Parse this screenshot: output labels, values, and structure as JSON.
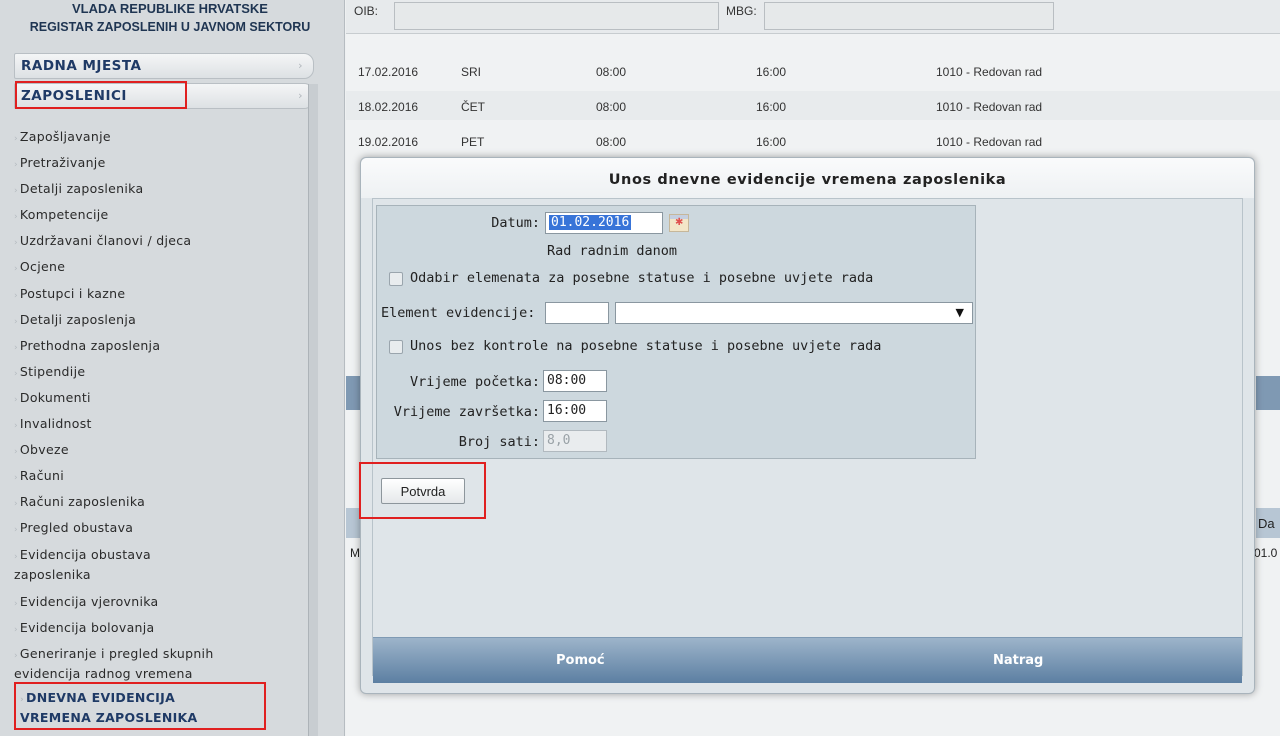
{
  "header": {
    "line1": "VLADA REPUBLIKE HRVATSKE",
    "line2": "REGISTAR ZAPOSLENIH U JAVNOM SEKTORU"
  },
  "topbar": {
    "oib_label": "OIB:",
    "mbg_label": "MBG:"
  },
  "sidebar": {
    "sections": [
      {
        "label": "RADNA MJESTA"
      },
      {
        "label": "ZAPOSLENICI"
      }
    ],
    "items": [
      {
        "label": "Zapošljavanje"
      },
      {
        "label": "Pretraživanje"
      },
      {
        "label": "Detalji zaposlenika"
      },
      {
        "label": "Kompetencije"
      },
      {
        "label": "Uzdržavani članovi / djeca"
      },
      {
        "label": "Ocjene"
      },
      {
        "label": "Postupci i kazne"
      },
      {
        "label": "Detalji zaposlenja"
      },
      {
        "label": "Prethodna zaposlenja"
      },
      {
        "label": "Stipendije"
      },
      {
        "label": "Dokumenti"
      },
      {
        "label": "Invalidnost"
      },
      {
        "label": "Obveze"
      },
      {
        "label": "Računi"
      },
      {
        "label": "Računi zaposlenika"
      },
      {
        "label": "Pregled obustava"
      },
      {
        "label": "Evidencija obustava",
        "label2": "zaposlenika"
      },
      {
        "label": "Evidencija vjerovnika"
      },
      {
        "label": "Evidencija bolovanja"
      },
      {
        "label": "Generiranje i pregled skupnih",
        "label2": "evidencija radnog vremena"
      },
      {
        "label": "DNEVNA EVIDENCIJA",
        "label2": "VREMENA ZAPOSLENIKA"
      }
    ]
  },
  "table": {
    "rows": [
      {
        "date": "17.02.2016",
        "day": "SRI",
        "start": "08:00",
        "end": "16:00",
        "type": "1010 - Redovan rad"
      },
      {
        "date": "18.02.2016",
        "day": "ČET",
        "start": "08:00",
        "end": "16:00",
        "type": "1010 - Redovan rad"
      },
      {
        "date": "19.02.2016",
        "day": "PET",
        "start": "08:00",
        "end": "16:00",
        "type": "1010 - Redovan rad"
      }
    ],
    "peek_right_1": "Da",
    "peek_right_2": "01.0",
    "peek_left_m": "M"
  },
  "modal": {
    "title": "Unos dnevne evidencije vremena zaposlenika",
    "datum_label": "Datum:",
    "datum_value": "01.02.2016",
    "day_type": "Rad radnim danom",
    "checkbox1_label": "Odabir elemenata za posebne statuse i posebne uvjete rada",
    "element_label": "Element evidencije:",
    "element_code": "",
    "element_select": "",
    "checkbox2_label": "Unos bez kontrole na posebne statuse i posebne uvjete rada",
    "start_label": "Vrijeme početka:",
    "start_value": "08:00",
    "end_label": "Vrijeme završetka:",
    "end_value": "16:00",
    "hours_label": "Broj sati:",
    "hours_value": "8,0",
    "confirm_label": "Potvrda",
    "help_label": "Pomoć",
    "back_label": "Natrag"
  }
}
